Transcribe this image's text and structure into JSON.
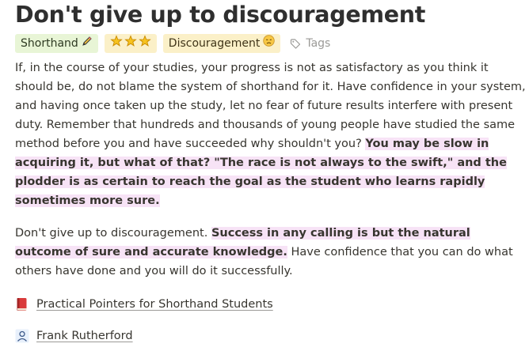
{
  "page": {
    "title": "Don't give up to discouragement"
  },
  "tags": {
    "shorthand": {
      "label": "Shorthand",
      "emoji": "✏️"
    },
    "rating": {
      "stars": "⭐⭐⭐",
      "value": 3,
      "max": 3
    },
    "discouragement": {
      "label": "Discouragement",
      "emoji": "😞"
    },
    "placeholder": "Tags"
  },
  "body": {
    "p1_normal": "If, in the course of your studies, your progress is not as satisfactory as you think it should be, do not blame the system of shorthand for it. Have confidence in your system, and having once taken up the study, let no fear of future results interfere with present duty. Remember that hundreds and thousands of young people have studied the same method before you and have succeeded why shouldn't you? ",
    "p1_highlight": "You may be slow in acquiring it, but what of that? \"The race is not always to the swift,\" and the plodder is as certain to reach the goal as the student who learns rapidly sometimes more sure.",
    "p2_start": "Don't give up to discouragement. ",
    "p2_highlight": "Success in any calling is but the natural outcome of sure and accurate knowledge.",
    "p2_end": " Have confidence that you can do what others have done and you will do it successfully."
  },
  "links": {
    "book": {
      "label": "Practical Pointers for Shorthand Students",
      "icon": "book-icon"
    },
    "author": {
      "label": "Frank Rutherford",
      "icon": "person-icon"
    }
  },
  "colors": {
    "highlight": "#f7e3f6",
    "tag_green": "#e8f5d6",
    "tag_yellow": "#fbf0c8",
    "text": "#37352f"
  }
}
